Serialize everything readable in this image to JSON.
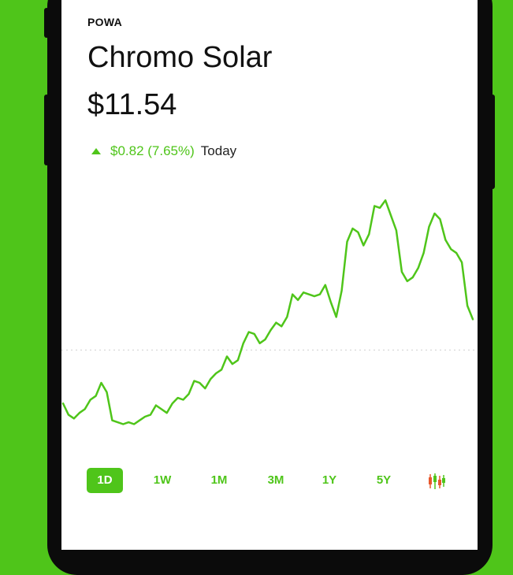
{
  "stock": {
    "ticker": "POWA",
    "name": "Chromo Solar",
    "price": "$11.54",
    "change": "$0.82 (7.65%)",
    "period_label": "Today"
  },
  "colors": {
    "accent": "#4fc51a",
    "background": "#4fc51a",
    "candle_down": "#e8582c"
  },
  "ranges": {
    "items": [
      "1D",
      "1W",
      "1M",
      "3M",
      "1Y",
      "5Y"
    ],
    "selected": "1D",
    "candlestick_icon": "candlestick-chart-icon"
  },
  "chart_data": {
    "type": "line",
    "y": [
      9.3,
      9.0,
      8.9,
      9.05,
      9.15,
      9.4,
      9.5,
      9.85,
      9.6,
      8.85,
      8.8,
      8.75,
      8.8,
      8.75,
      8.85,
      8.95,
      9.0,
      9.25,
      9.15,
      9.05,
      9.3,
      9.45,
      9.4,
      9.55,
      9.9,
      9.85,
      9.7,
      9.95,
      10.1,
      10.2,
      10.55,
      10.35,
      10.45,
      10.9,
      11.2,
      11.15,
      10.9,
      11.0,
      11.25,
      11.45,
      11.35,
      11.6,
      12.2,
      12.05,
      12.25,
      12.2,
      12.15,
      12.2,
      12.45,
      12.0,
      11.6,
      12.3,
      13.6,
      13.95,
      13.85,
      13.5,
      13.8,
      14.55,
      14.5,
      14.7,
      14.3,
      13.9,
      12.8,
      12.55,
      12.65,
      12.9,
      13.3,
      14.0,
      14.35,
      14.2,
      13.65,
      13.4,
      13.3,
      13.05,
      11.9,
      11.54
    ],
    "reference": 10.72,
    "ylim": [
      8.3,
      15.0
    ],
    "line_color": "#4fc51a"
  }
}
